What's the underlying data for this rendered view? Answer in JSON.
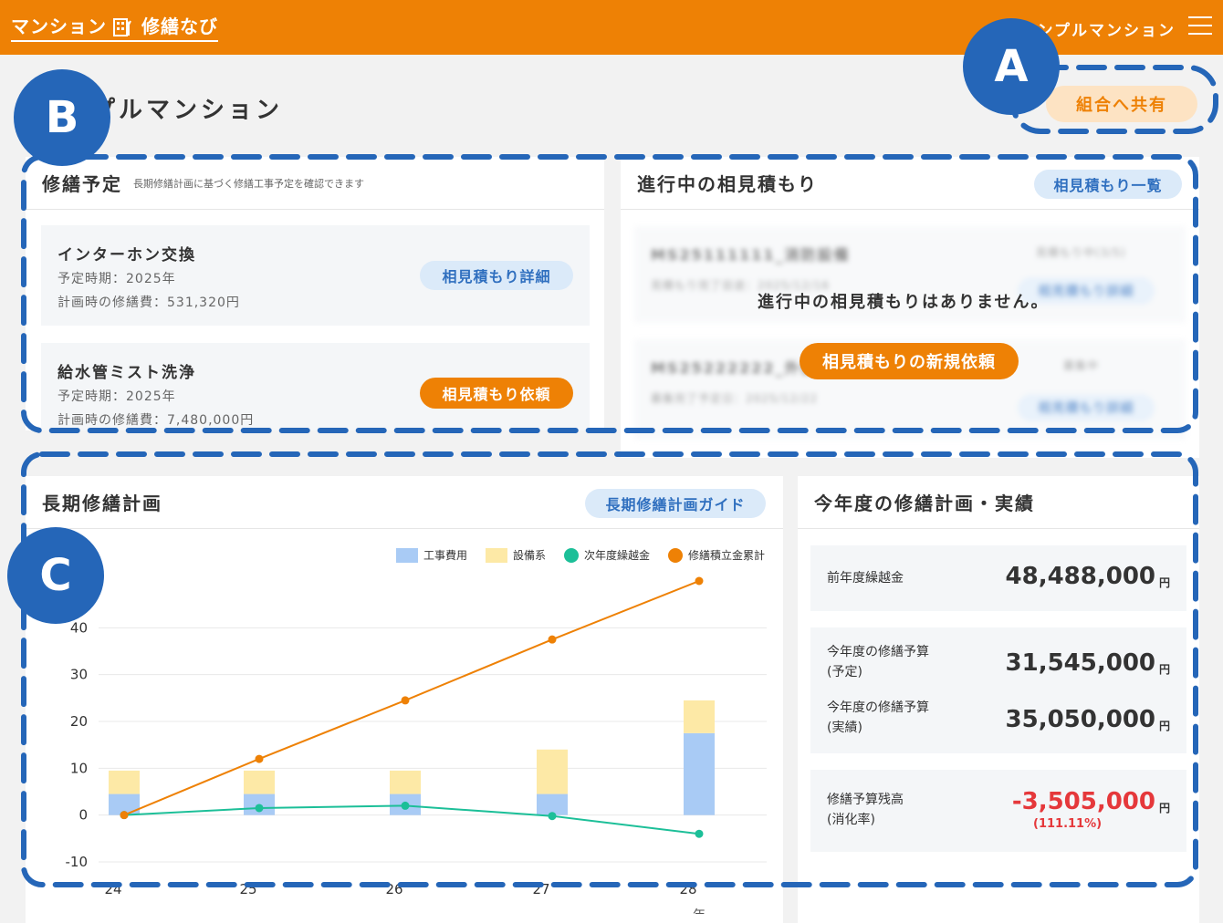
{
  "header": {
    "logo_left": "マンション",
    "logo_right": "修繕なび",
    "mansion_name": "ンプルマンション"
  },
  "page": {
    "title": "プルマンション",
    "share_label": "組合へ共有"
  },
  "schedule": {
    "title": "修繕予定",
    "subtitle": "長期修繕計画に基づく修繕工事予定を確認できます",
    "items": [
      {
        "name": "インターホン交換",
        "period": "予定時期：2025年",
        "cost": "計画時の修繕費：531,320円",
        "button": "相見積もり詳細"
      },
      {
        "name": "給水管ミスト洗浄",
        "period": "予定時期：2025年",
        "cost": "計画時の修繕費：7,480,000円",
        "button": "相見積もり依頼"
      }
    ]
  },
  "quotes": {
    "title": "進行中の相見積もり",
    "list_button": "相見積もり一覧",
    "blurred_rows": [
      {
        "name": "MS25111111_消防設備",
        "status": "見積もり中(3/5)",
        "sub": "見積もり完了目途：2025/12/16",
        "button": "相見積もり詳細"
      },
      {
        "name": "MS25222222_外壁改修",
        "status": "募集中",
        "sub": "募集完了予定日：2025/12/22",
        "button": "相見積もり詳細"
      }
    ],
    "empty_message": "進行中の相見積もりはありません。",
    "new_request": "相見積もりの新規依頼"
  },
  "long_term": {
    "title": "長期修繕計画",
    "guide_button": "長期修繕計画ガイド"
  },
  "chart_data": {
    "type": "bar",
    "categories": [
      "24",
      "25",
      "26",
      "27",
      "28"
    ],
    "xlabel": "年",
    "ylabel": "",
    "ylim": [
      -10,
      50
    ],
    "yticks": [
      "-10",
      "0",
      "10",
      "20",
      "30",
      "40"
    ],
    "series": [
      {
        "name": "工事費用",
        "kind": "bar-stacked",
        "color": "#a9cbf5",
        "values": [
          4.5,
          4.5,
          4.5,
          4.5,
          17.5
        ]
      },
      {
        "name": "設備系",
        "kind": "bar-stacked",
        "color": "#fde9a6",
        "values": [
          5,
          5,
          5,
          9.5,
          7
        ]
      },
      {
        "name": "次年度繰越金",
        "kind": "line",
        "color": "#1cbf98",
        "values": [
          0,
          1.5,
          2,
          -0.2,
          -4
        ]
      },
      {
        "name": "修繕積立金累計",
        "kind": "line",
        "color": "#ee8105",
        "values": [
          0,
          12,
          24.5,
          37.5,
          50
        ]
      }
    ]
  },
  "annual": {
    "title": "今年度の修繕計画・実績",
    "rows": [
      {
        "label1": "前年度繰越金",
        "label2": "",
        "value": "48,488,000",
        "yen": "円"
      },
      {
        "label1": "今年度の修繕予算",
        "label2": "(予定)",
        "value": "31,545,000",
        "yen": "円"
      },
      {
        "label1": "今年度の修繕予算",
        "label2": "(実績)",
        "value": "35,050,000",
        "yen": "円"
      },
      {
        "label1": "修繕予算残高",
        "label2": "(消化率)",
        "value": "-3,505,000",
        "yen": "円",
        "note": "(111.11%)"
      }
    ],
    "negative_color": "#e5383b"
  },
  "callouts": {
    "a": "A",
    "b": "B",
    "c": "C"
  }
}
